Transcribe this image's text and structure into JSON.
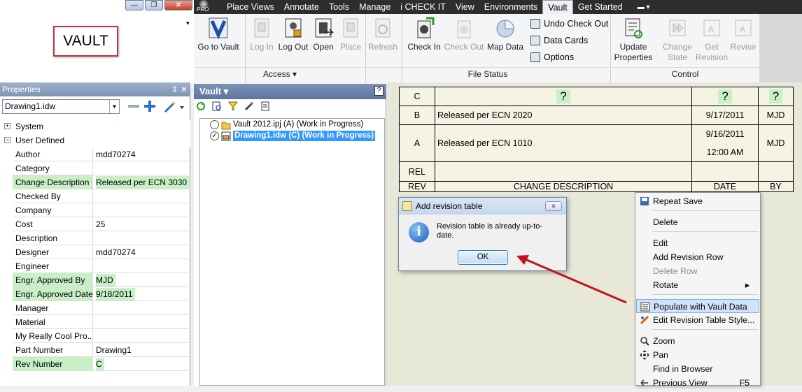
{
  "window": {
    "minimize": "—",
    "maximize": "❐",
    "close": "✕"
  },
  "logo_text": "VAULT",
  "ribbon": {
    "app_badge": "PRO",
    "tabs": [
      "Place Views",
      "Annotate",
      "Tools",
      "Manage",
      "i CHECK IT",
      "View",
      "Environments",
      "Vault",
      "Get Started"
    ],
    "active_tab": "Vault",
    "buttons": {
      "go_to_vault": "Go to Vault",
      "log_in": "Log In",
      "log_out": "Log Out",
      "open": "Open",
      "place": "Place",
      "refresh": "Refresh",
      "check_in": "Check In",
      "check_out": "Check Out",
      "map_data": "Map Data",
      "undo_check_out": "Undo Check Out",
      "data_cards": "Data Cards",
      "options": "Options",
      "update_properties_1": "Update",
      "update_properties_2": "Properties",
      "change_state_1": "Change",
      "change_state_2": "State",
      "get_revision_1": "Get",
      "get_revision_2": "Revision",
      "revise": "Revise"
    },
    "groups": {
      "access": "Access ▾",
      "file_status": "File Status",
      "control": "Control"
    }
  },
  "properties": {
    "title": "Properties",
    "controls": "⇕ ✕",
    "document": "Drawing1.idw",
    "groups": {
      "system": "System",
      "user_defined": "User Defined"
    },
    "rows": [
      {
        "k": "Author",
        "v": "mdd70274",
        "hk": false,
        "hv": false
      },
      {
        "k": "Category",
        "v": "",
        "hk": false,
        "hv": false
      },
      {
        "k": "Change Description",
        "v": "Released per ECN 3030",
        "hk": true,
        "hv": true
      },
      {
        "k": "Checked By",
        "v": "",
        "hk": false,
        "hv": false
      },
      {
        "k": "Company",
        "v": "",
        "hk": false,
        "hv": false
      },
      {
        "k": "Cost",
        "v": "25",
        "hk": false,
        "hv": false
      },
      {
        "k": "Description",
        "v": "",
        "hk": false,
        "hv": false
      },
      {
        "k": "Designer",
        "v": "mdd70274",
        "hk": false,
        "hv": false
      },
      {
        "k": "Engineer",
        "v": "",
        "hk": false,
        "hv": false
      },
      {
        "k": "Engr. Approved By",
        "v": "MJD",
        "hk": true,
        "hv": true
      },
      {
        "k": "Engr. Approved Date",
        "v": "9/18/2011",
        "hk": true,
        "hv": true
      },
      {
        "k": "Manager",
        "v": "",
        "hk": false,
        "hv": false
      },
      {
        "k": "Material",
        "v": "",
        "hk": false,
        "hv": false
      },
      {
        "k": "My Really Cool Pro...",
        "v": "",
        "hk": false,
        "hv": false
      },
      {
        "k": "Part Number",
        "v": "Drawing1",
        "hk": false,
        "hv": false
      },
      {
        "k": "Rev Number",
        "v": "C",
        "hk": true,
        "hv": true
      }
    ]
  },
  "vault": {
    "title": "Vault ▾",
    "help": "?",
    "items": [
      {
        "label": "Vault 2012.ipj (A) (Work in Progress)"
      },
      {
        "label": "Drawing1.idw (C) (Work in Progress)"
      }
    ]
  },
  "revision_table": {
    "rows": [
      {
        "rev": "C",
        "desc": "?",
        "date": "?",
        "by": "?"
      },
      {
        "rev": "B",
        "desc": "Released per ECN 2020",
        "date": "9/17/2011",
        "by": "MJD"
      },
      {
        "rev": "A",
        "desc": "Released per ECN 1010",
        "date": "9/16/2011",
        "time": "12:00 AM",
        "by": "MJD"
      },
      {
        "rev": "REL",
        "desc": "",
        "date": "",
        "by": ""
      }
    ],
    "headers": {
      "rev": "REV",
      "desc": "CHANGE DESCRIPTION",
      "date": "DATE",
      "by": "BY"
    }
  },
  "dialog": {
    "title": "Add revision table",
    "message": "Revision table is already up-to-date.",
    "ok": "OK",
    "close": "✕"
  },
  "context_menu": {
    "items": [
      {
        "label": "Repeat Save",
        "shortcut": ""
      },
      {
        "label": "Delete",
        "shortcut": ""
      },
      {
        "label": "Edit",
        "shortcut": ""
      },
      {
        "label": "Add Revision Row",
        "shortcut": ""
      },
      {
        "label": "Delete Row",
        "shortcut": ""
      },
      {
        "label": "Rotate",
        "shortcut": "▸"
      },
      {
        "label": "Populate with Vault Data",
        "shortcut": ""
      },
      {
        "label": "Edit Revision Table Style...",
        "shortcut": ""
      },
      {
        "label": "Zoom",
        "shortcut": ""
      },
      {
        "label": "Pan",
        "shortcut": ""
      },
      {
        "label": "Find in Browser",
        "shortcut": ""
      },
      {
        "label": "Previous View",
        "shortcut": "F5"
      }
    ]
  },
  "colors": {
    "highlight": "#c7f0c6",
    "accent": "#3399ff",
    "arrow": "#c0141c"
  }
}
